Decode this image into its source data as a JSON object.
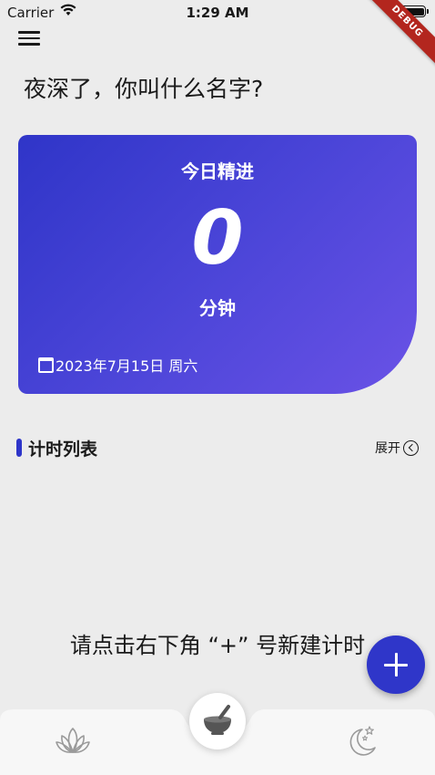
{
  "status_bar": {
    "carrier": "Carrier",
    "time": "1:29 AM"
  },
  "debug_banner": "DEBUG",
  "greeting": "夜深了，你叫什么名字?",
  "today_card": {
    "title": "今日精进",
    "minutes": "0",
    "unit": "分钟",
    "date": "2023年7月15日 周六"
  },
  "timer_section": {
    "title": "计时列表",
    "expand_label": "展开"
  },
  "empty_hint": "请点击右下角 “+” 号新建计时",
  "colors": {
    "accent": "#2f36c9",
    "card_gradient_start": "#2f35c8",
    "card_gradient_end": "#6a52e6",
    "background": "#ececec"
  },
  "bottom_nav": {
    "items": [
      "lotus-icon",
      "meditation-bowl-icon",
      "moon-stars-icon"
    ]
  }
}
